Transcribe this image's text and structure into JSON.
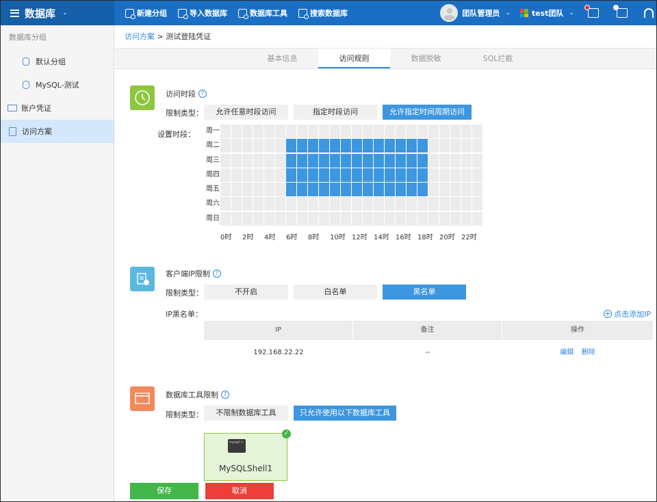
{
  "topbar": {
    "title": "数据库",
    "actions": [
      {
        "label": "新建分组",
        "icon": "add-group-icon"
      },
      {
        "label": "导入数据库",
        "icon": "import-icon"
      },
      {
        "label": "数据库工具",
        "icon": "db-tool-icon"
      },
      {
        "label": "搜索数据库",
        "icon": "search-db-icon"
      }
    ],
    "user": "团队管理员",
    "team": "test团队",
    "colors": {
      "bar": "#1a6fc4",
      "brand_bg": "#165fa9"
    }
  },
  "sidebar": {
    "heading": "数据库分组",
    "items": [
      {
        "label": "默认分组",
        "icon": "database-icon"
      },
      {
        "label": "MySQL-测试",
        "icon": "database-icon"
      },
      {
        "label": "账户凭证",
        "icon": "credential-card-icon"
      },
      {
        "label": "访问方案",
        "icon": "clipboard-icon",
        "active": true
      }
    ]
  },
  "breadcrumb": {
    "link": "访问方案",
    "separator": ">",
    "current": "测试登陆凭证"
  },
  "tabs": [
    {
      "label": "基本信息"
    },
    {
      "label": "访问规则",
      "active": true
    },
    {
      "label": "数据脱敏"
    },
    {
      "label": "SQL拦截"
    }
  ],
  "time_section": {
    "title": "访问时段",
    "type_label": "限制类型：",
    "options": [
      "允许任意时段访问",
      "指定时段访问",
      "允许指定时间周期访问"
    ],
    "selected": 2,
    "grid_label": "设置时段：",
    "days": [
      "周一",
      "周二",
      "周三",
      "周四",
      "周五",
      "周六",
      "周日"
    ],
    "hours": [
      "0时",
      "2时",
      "4时",
      "6时",
      "8时",
      "10时",
      "12时",
      "14时",
      "16时",
      "18时",
      "20时",
      "22时"
    ],
    "selected_days": [
      1,
      2,
      3,
      4
    ],
    "selected_hour_start": 6,
    "selected_hour_end": 19,
    "accent": "#3d96e0"
  },
  "ip_section": {
    "title": "客户端IP限制",
    "type_label": "限制类型：",
    "options": [
      "不开启",
      "白名单",
      "黑名单"
    ],
    "selected": 2,
    "list_label": "IP黑名单：",
    "add_label": "点击添加IP",
    "columns": [
      "IP",
      "备注",
      "操作"
    ],
    "rows": [
      {
        "ip": "192.168.22.22",
        "note": "--",
        "edit": "编辑",
        "delete": "删除"
      }
    ]
  },
  "tool_section": {
    "title": "数据库工具限制",
    "type_label": "限制类型：",
    "options": [
      "不限制数据库工具",
      "只允许使用以下数据库工具"
    ],
    "selected": 1,
    "tools": [
      {
        "name": "MySQLShell1",
        "icon_text": "mysql >",
        "checked": true
      }
    ]
  },
  "footer": {
    "save": "保存",
    "cancel": "取消"
  }
}
